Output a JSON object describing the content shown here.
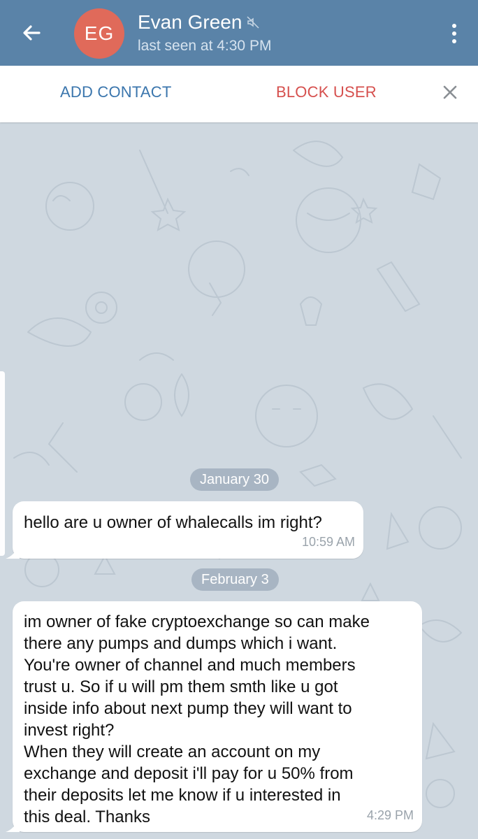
{
  "header": {
    "contact_name": "Evan Green",
    "avatar_initials": "EG",
    "status": "last seen at 4:30 PM"
  },
  "action_bar": {
    "add_contact": "ADD CONTACT",
    "block_user": "BLOCK USER"
  },
  "colors": {
    "header_bg": "#5a83a8",
    "avatar_bg": "#e06a5a",
    "add_contact": "#3b76ad",
    "block_user": "#d6504e",
    "chat_bg": "#cfd8e0"
  },
  "messages": [
    {
      "date": "January 30",
      "text": "hello are u owner of whalecalls im right?",
      "time": "10:59 AM"
    },
    {
      "date": "February 3",
      "text": "im owner of fake cryptoexchange so can make\nthere any pumps and dumps which i want.\nYou're owner of channel and much members\ntrust u. So if u will pm them smth like u got\ninside info about next pump they will want to\ninvest right?\nWhen they will create an account on my\nexchange and deposit i'll pay for u 50% from\ntheir deposits let me know if u interested in\nthis deal. Thanks",
      "time": "4:29 PM"
    }
  ]
}
